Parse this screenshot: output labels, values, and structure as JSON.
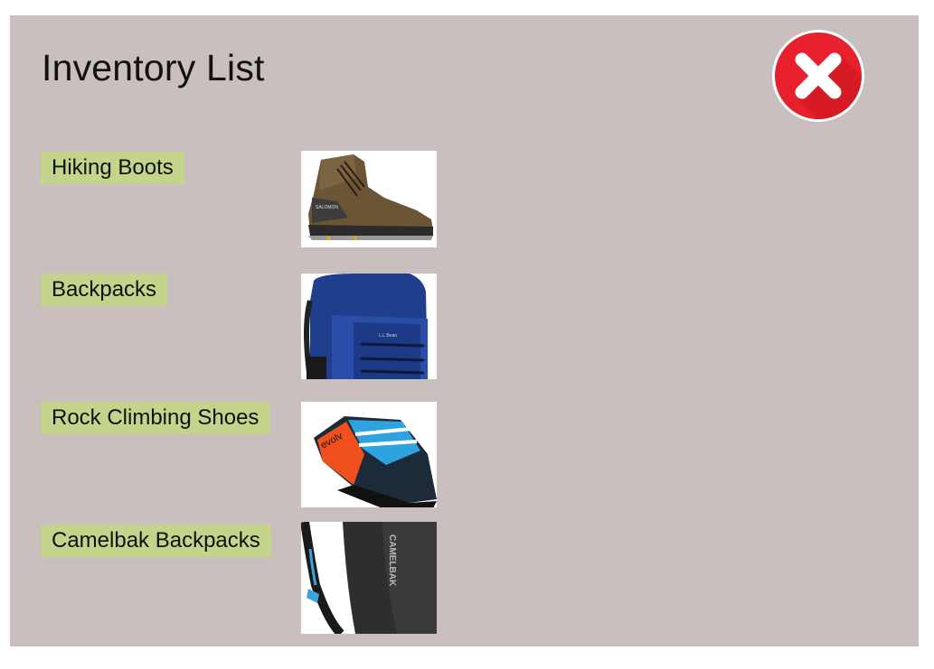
{
  "page": {
    "title": "Inventory List"
  },
  "close_button": {
    "icon": "close-icon",
    "color": "#e8202e"
  },
  "items": [
    {
      "label": "Hiking Boots",
      "image_icon": "hiking-boot-image"
    },
    {
      "label": "Backpacks",
      "image_icon": "backpack-image"
    },
    {
      "label": "Rock Climbing Shoes",
      "image_icon": "climbing-shoe-image"
    },
    {
      "label": "Camelbak Backpacks",
      "image_icon": "hydration-pack-image",
      "image_text": "CAMELBAK"
    }
  ],
  "colors": {
    "panel_background": "#c9bfbf",
    "label_highlight": "#c4d48b",
    "close_red": "#e8202e"
  }
}
